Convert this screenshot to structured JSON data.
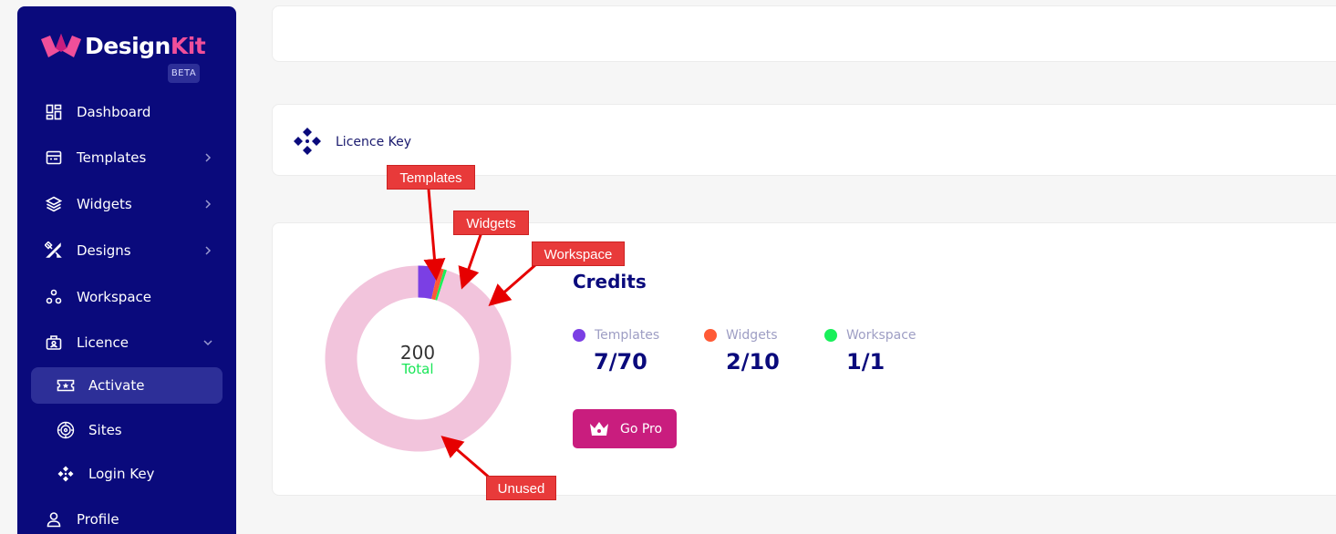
{
  "brand": {
    "name_part1": "Design",
    "name_part2": "Kit",
    "badge": "BETA",
    "accent": "#f04f9a",
    "sidebar_bg": "#0a0a7c"
  },
  "sidebar": {
    "items": [
      {
        "label": "Dashboard",
        "icon": "dashboard-icon"
      },
      {
        "label": "Templates",
        "icon": "templates-icon",
        "has_chevron": true
      },
      {
        "label": "Widgets",
        "icon": "widgets-icon",
        "has_chevron": true
      },
      {
        "label": "Designs",
        "icon": "designs-icon",
        "has_chevron": true
      },
      {
        "label": "Workspace",
        "icon": "workspace-icon"
      },
      {
        "label": "Licence",
        "icon": "licence-icon",
        "expanded": true
      },
      {
        "label": "Activate",
        "icon": "ticket-icon",
        "active": true
      },
      {
        "label": "Sites",
        "icon": "globe-icon"
      },
      {
        "label": "Login Key",
        "icon": "key-icon"
      },
      {
        "label": "Profile",
        "icon": "profile-icon"
      }
    ]
  },
  "licence_card": {
    "label": "Licence Key",
    "icon": "licence-key-icon"
  },
  "credits": {
    "title": "Credits",
    "total": "200",
    "total_label": "Total",
    "legend": [
      {
        "label": "Templates",
        "value": "7/70",
        "color": "#7b3fe4"
      },
      {
        "label": "Widgets",
        "value": "2/10",
        "color": "#ff5a36"
      },
      {
        "label": "Workspace",
        "value": "1/1",
        "color": "#19f05a"
      }
    ],
    "unused_color": "#f2c4dc",
    "button": "Go Pro",
    "button_icon": "crown-icon"
  },
  "chart_data": {
    "type": "pie",
    "categories": [
      "Templates",
      "Widgets",
      "Workspace",
      "Unused"
    ],
    "values": [
      7,
      2,
      1,
      190
    ],
    "total": 200
  },
  "annotations": {
    "templates": "Templates",
    "widgets": "Widgets",
    "workspace": "Workspace",
    "unused": "Unused",
    "color": "#e83a3a"
  }
}
